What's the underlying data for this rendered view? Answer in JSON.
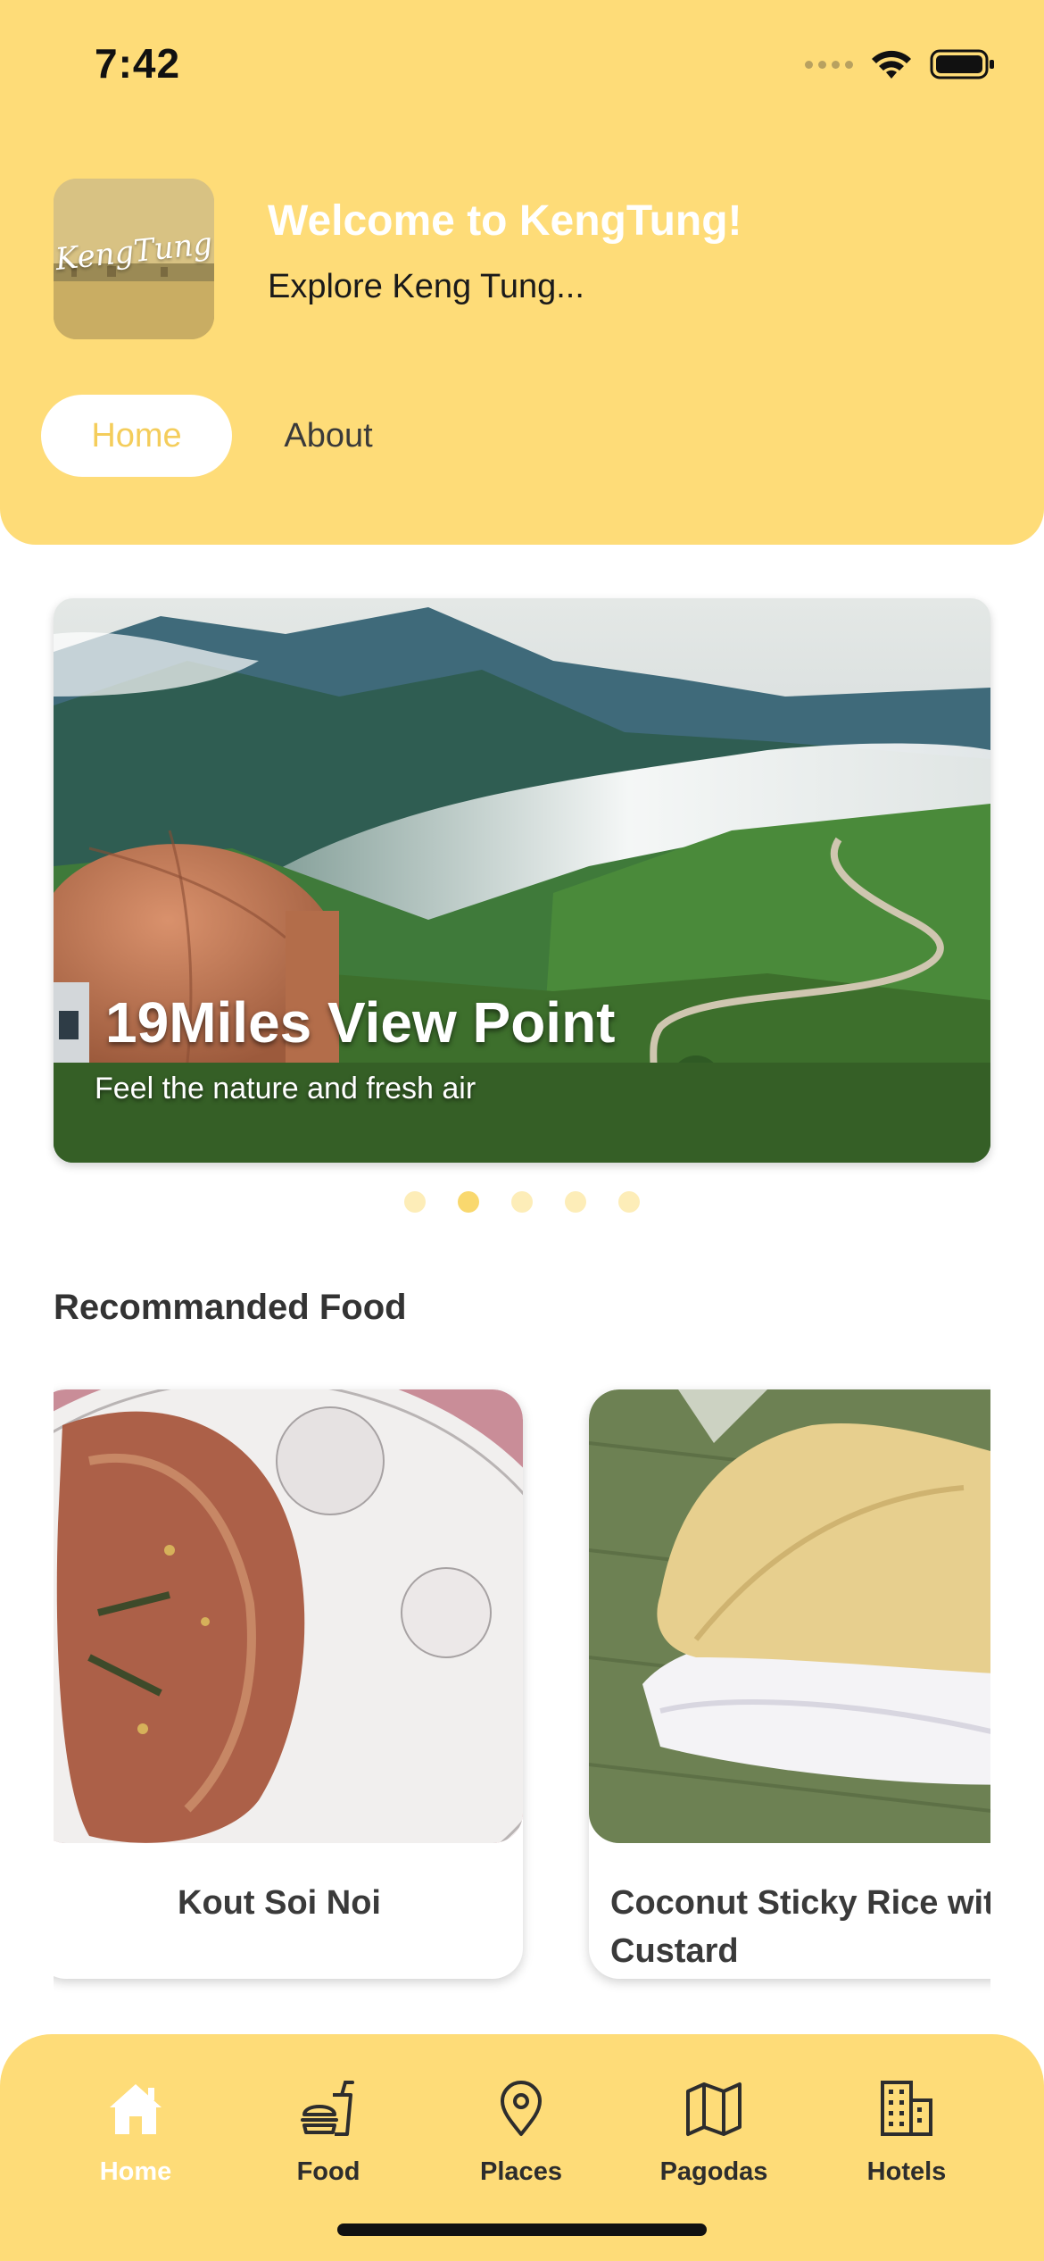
{
  "status_bar": {
    "time": "7:42"
  },
  "header": {
    "logo_text": "KengTung",
    "title": "Welcome to KengTung!",
    "subtitle": "Explore Keng Tung...",
    "tabs": [
      {
        "label": "Home",
        "active": true
      },
      {
        "label": "About",
        "active": false
      }
    ]
  },
  "hero": {
    "title": "19Miles View Point",
    "subtitle": "Feel the nature and fresh air",
    "pagination": {
      "count": 5,
      "active_index": 1
    }
  },
  "food_section": {
    "title": "Recommanded Food",
    "items": [
      {
        "name": "Kout Soi Noi",
        "image": "dumpling-photo"
      },
      {
        "name": "Coconut Sticky Rice with Custard",
        "image": "sticky-rice-photo"
      }
    ]
  },
  "bottom_nav": {
    "items": [
      {
        "label": "Home",
        "icon": "home-icon",
        "active": true
      },
      {
        "label": "Food",
        "icon": "food-icon",
        "active": false
      },
      {
        "label": "Places",
        "icon": "location-pin-icon",
        "active": false
      },
      {
        "label": "Pagodas",
        "icon": "map-icon",
        "active": false
      },
      {
        "label": "Hotels",
        "icon": "building-icon",
        "active": false
      }
    ]
  },
  "colors": {
    "brand_yellow": "#fedc78",
    "active_tab_text": "#f4cd5b",
    "dot_active": "#f9d86e",
    "dot_inactive": "#fdedb8"
  }
}
